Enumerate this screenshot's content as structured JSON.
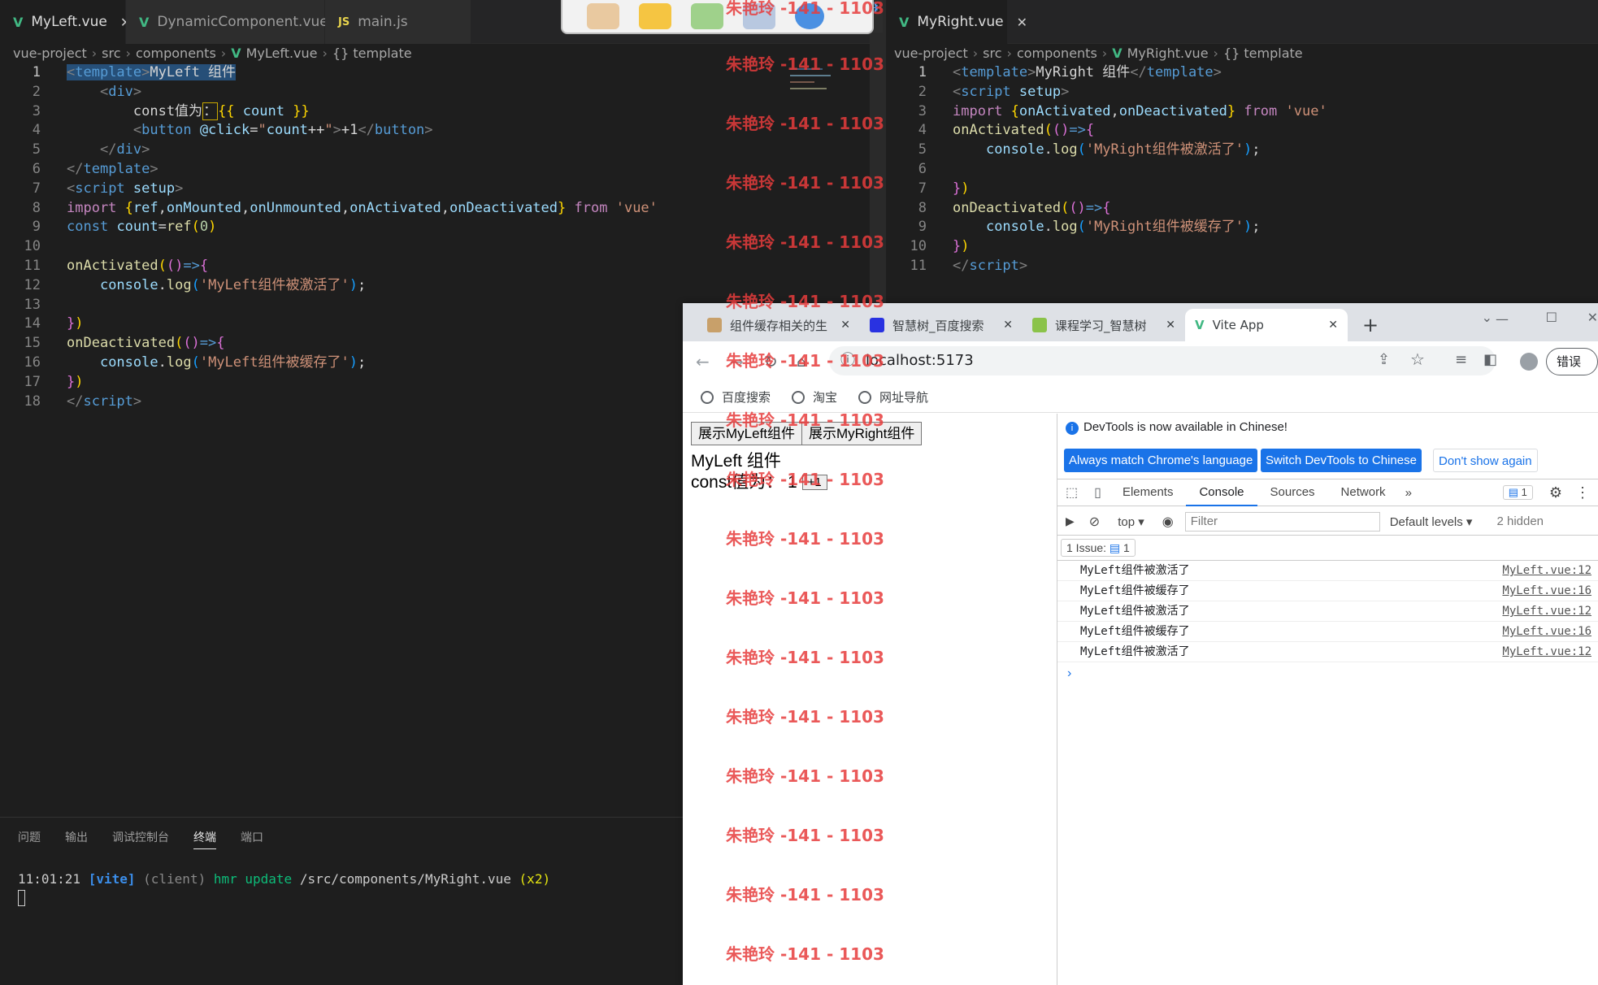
{
  "left_editor": {
    "tabs": [
      {
        "label": "MyLeft.vue",
        "icon": "vue-icon",
        "active": true
      },
      {
        "label": "DynamicComponent.vue",
        "icon": "vue-icon",
        "active": false
      },
      {
        "label": "main.js",
        "icon": "js-icon",
        "active": false
      }
    ],
    "breadcrumb": [
      "vue-project",
      "src",
      "components",
      "MyLeft.vue",
      "{} template"
    ],
    "line_numbers": [
      "1",
      "2",
      "3",
      "4",
      "5",
      "6",
      "7",
      "8",
      "9",
      "10",
      "11",
      "12",
      "13",
      "14",
      "15",
      "16",
      "17",
      "18"
    ]
  },
  "right_editor": {
    "tab": "MyRight.vue",
    "breadcrumb": [
      "vue-project",
      "src",
      "components",
      "MyRight.vue",
      "{} template"
    ],
    "line_numbers": [
      "1",
      "2",
      "3",
      "4",
      "5",
      "6",
      "7",
      "8",
      "9",
      "10",
      "11"
    ]
  },
  "panel": {
    "tabs": [
      "问题",
      "输出",
      "调试控制台",
      "终端",
      "端口"
    ],
    "terminal": {
      "time": "11:01:21",
      "tag": "[vite]",
      "client": "(client)",
      "cmd": "hmr update",
      "path": "/src/components/MyRight.vue",
      "count": "(x2)"
    }
  },
  "browser": {
    "tabs": [
      "组件缓存相关的生",
      "智慧树_百度搜索",
      "课程学习_智慧树",
      "Vite App"
    ],
    "url": "localhost:5173",
    "user_button": "错误",
    "bookmarks": [
      "百度搜索",
      "淘宝",
      "网址导航"
    ],
    "page": {
      "buttons": [
        "展示MyLeft组件",
        "展示MyRight组件"
      ],
      "title": "MyLeft 组件",
      "const_label": "const值为：",
      "count": "1",
      "inc_button": "+1"
    },
    "devtools": {
      "banner": "DevTools is now available in Chinese!",
      "buttons": [
        "Always match Chrome's language",
        "Switch DevTools to Chinese",
        "Don't show again"
      ],
      "tabs": [
        "Elements",
        "Console",
        "Sources",
        "Network"
      ],
      "issue_count": "1",
      "context": "top",
      "filter_placeholder": "Filter",
      "levels": "Default levels",
      "hidden": "2 hidden",
      "issues_label": "1 Issue:",
      "logs": [
        {
          "msg": "MyLeft组件被激活了",
          "src": "MyLeft.vue:12"
        },
        {
          "msg": "MyLeft组件被缓存了",
          "src": "MyLeft.vue:16"
        },
        {
          "msg": "MyLeft组件被激活了",
          "src": "MyLeft.vue:12"
        },
        {
          "msg": "MyLeft组件被缓存了",
          "src": "MyLeft.vue:16"
        },
        {
          "msg": "MyLeft组件被激活了",
          "src": "MyLeft.vue:12"
        }
      ]
    }
  },
  "watermark": "朱艳玲 -141 - 1103"
}
